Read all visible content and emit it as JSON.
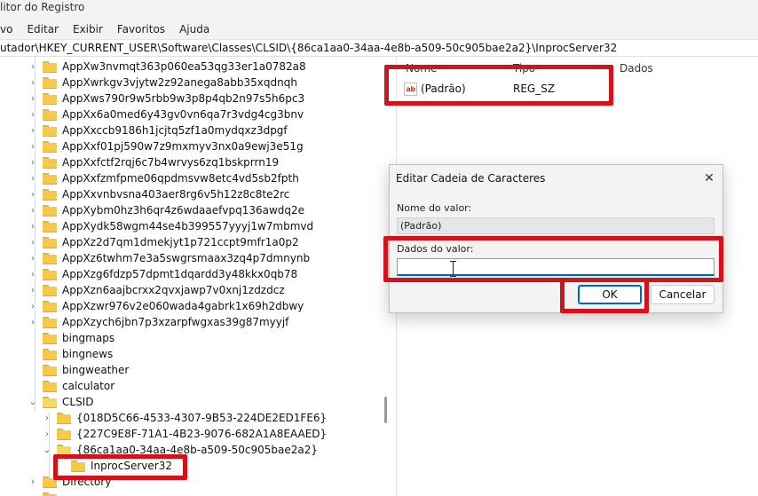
{
  "window": {
    "title": "litor do Registro"
  },
  "menu": [
    "vo",
    "Editar",
    "Exibir",
    "Favoritos",
    "Ajuda"
  ],
  "address": {
    "path": "utador\\HKEY_CURRENT_USER\\Software\\Classes\\CLSID\\{86ca1aa0-34aa-4e8b-a509-50c905bae2a2}\\InprocServer32"
  },
  "tree": {
    "app_keys": [
      "AppXw3nvmqt363p060ea53qg33er1a0782a8",
      "AppXwrkgv3vjytw2z92anega8abb35xqdnqh",
      "AppXws790r9w5rbb9w3p8p4qb2n97s5h6pc3",
      "AppXx6a0med6y43gv0vn6qa7r3vdg4cg3bnv",
      "AppXxccb9186h1jcjtq5zf1a0mydqxz3dpgf",
      "AppXxf01pj590w7z9mxmyv3nx0a9ewj3e51g",
      "AppXxfctf2rqj6c7b4wrvys6zq1bskprrn19",
      "AppXxfzmfpme06qpdmsvw8etc4vd5sb2fpth",
      "AppXxvnbvsna403aer8rg6v5h12z8c8te2rc",
      "AppXybm0hz3h6qr4z6wdaaefvpq136awdq2e",
      "AppXydk58wgm44se4b399557yyyj1w7mbmvd",
      "AppXz2d7qm1dmekjyt1p721ccpt9mfr1a0p2",
      "AppXz6twhm7e3a5swgrsmaax3zq4p7dmnynb",
      "AppXzg6fdzp57dpmt1dqardd3y48kkx0qb78",
      "AppXzn6aajbcrxx2qvxjawp7v0xnj1zdzdcz",
      "AppXzwr976v2e060wada4gabrk1x69h2dbwy",
      "AppXzych6jbn7p3xzarpfwgxas39g87myyjf"
    ],
    "plain_keys": [
      "bingmaps",
      "bingnews",
      "bingweather",
      "calculator"
    ],
    "clsid": "CLSID",
    "clsid_children": [
      "{018D5C66-4533-4307-9B53-224DE2ED1FE6}",
      "{227C9E8F-71A1-4B23-9076-682A1A8EAAED}",
      "{86ca1aa0-34aa-4e8b-a509-50c905bae2a2}"
    ],
    "selected_subkey": "InprocServer32",
    "after_keys": [
      "Directory",
      "..."
    ]
  },
  "values_pane": {
    "columns": {
      "name": "Nome",
      "type": "Tipo",
      "data": "Dados"
    },
    "row": {
      "name": "(Padrão)",
      "type": "REG_SZ",
      "data": ""
    }
  },
  "dialog": {
    "title": "Editar Cadeia de Caracteres",
    "value_name_label": "Nome do valor:",
    "value_name": "(Padrão)",
    "value_data_label": "Dados do valor:",
    "value_data": "",
    "ok_label": "OK",
    "cancel_label": "Cancelar"
  },
  "colors": {
    "highlight": "#d3131b",
    "accent": "#0067c0",
    "folder": "#f6c94a"
  }
}
